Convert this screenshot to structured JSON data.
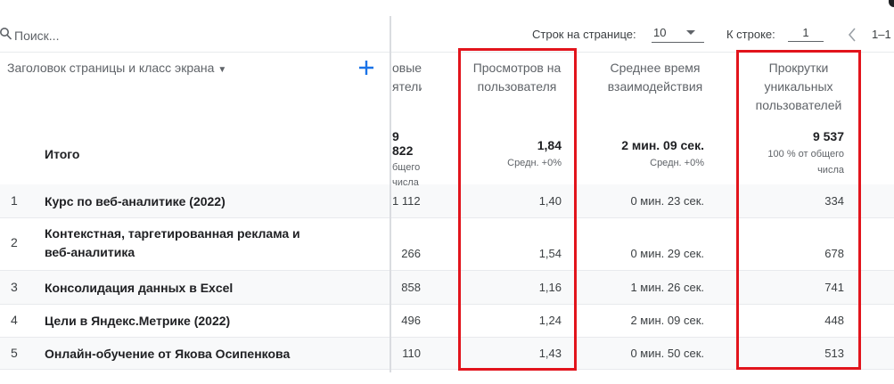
{
  "search": {
    "placeholder": "Поиск..."
  },
  "pager": {
    "rows_per_page_label": "Строк на странице:",
    "rows_per_page_value": "10",
    "goto_row_label": "К строке:",
    "goto_row_value": "1",
    "range_text": "1–1"
  },
  "dimension": {
    "header_label": "Заголовок страницы и класс экрана"
  },
  "columns": [
    {
      "label_line1": "овые",
      "label_line2": "ятели"
    },
    {
      "label_line1": "Просмотров на",
      "label_line2": "пользователя"
    },
    {
      "label_line1": "Среднее время",
      "label_line2": "взаимодействия"
    },
    {
      "label_line1": "Прокрутки",
      "label_line2": "уникальных",
      "label_line3": "пользователей"
    }
  ],
  "totals": {
    "label": "Итого",
    "col1_value": "9 822",
    "col1_sub1": "бщего",
    "col1_sub2": "числа",
    "col2_value": "1,84",
    "col2_sub": "Средн. +0%",
    "col3_value": "2 мин. 09 сек.",
    "col3_sub": "Средн. +0%",
    "col4_value": "9 537",
    "col4_sub1": "100 % от общего",
    "col4_sub2": "числа"
  },
  "rows": [
    {
      "num": "1",
      "title": "Курс по веб-аналитике (2022)",
      "c1": "1 112",
      "c2": "1,40",
      "c3": "0 мин. 23 сек.",
      "c4": "334"
    },
    {
      "num": "2",
      "title_line1": "Контекстная, таргетированная реклама и",
      "title_line2": "веб-аналитика",
      "c1": "266",
      "c2": "1,54",
      "c3": "0 мин. 29 сек.",
      "c4": "678"
    },
    {
      "num": "3",
      "title": "Консолидация данных в Excel",
      "c1": "858",
      "c2": "1,16",
      "c3": "1 мин. 26 сек.",
      "c4": "741"
    },
    {
      "num": "4",
      "title": "Цели в Яндекс.Метрике (2022)",
      "c1": "496",
      "c2": "1,24",
      "c3": "2 мин. 09 сек.",
      "c4": "448"
    },
    {
      "num": "5",
      "title": "Онлайн-обучение от Якова Осипенкова",
      "c1": "110",
      "c2": "1,43",
      "c3": "0 мин. 50 сек.",
      "c4": "513"
    }
  ],
  "colors": {
    "highlight_border": "#e2141c",
    "accent_blue": "#1a73e8"
  }
}
